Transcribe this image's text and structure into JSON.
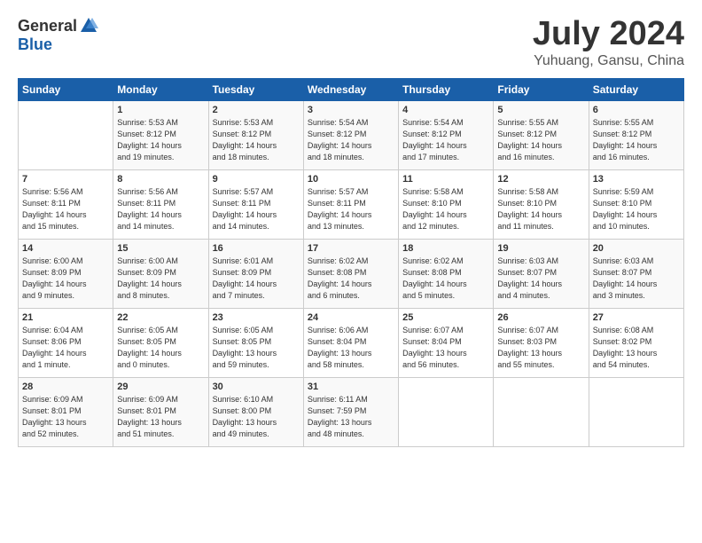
{
  "header": {
    "logo_general": "General",
    "logo_blue": "Blue",
    "title": "July 2024",
    "location": "Yuhuang, Gansu, China"
  },
  "days_of_week": [
    "Sunday",
    "Monday",
    "Tuesday",
    "Wednesday",
    "Thursday",
    "Friday",
    "Saturday"
  ],
  "weeks": [
    [
      {
        "day": "",
        "info": ""
      },
      {
        "day": "1",
        "info": "Sunrise: 5:53 AM\nSunset: 8:12 PM\nDaylight: 14 hours\nand 19 minutes."
      },
      {
        "day": "2",
        "info": "Sunrise: 5:53 AM\nSunset: 8:12 PM\nDaylight: 14 hours\nand 18 minutes."
      },
      {
        "day": "3",
        "info": "Sunrise: 5:54 AM\nSunset: 8:12 PM\nDaylight: 14 hours\nand 18 minutes."
      },
      {
        "day": "4",
        "info": "Sunrise: 5:54 AM\nSunset: 8:12 PM\nDaylight: 14 hours\nand 17 minutes."
      },
      {
        "day": "5",
        "info": "Sunrise: 5:55 AM\nSunset: 8:12 PM\nDaylight: 14 hours\nand 16 minutes."
      },
      {
        "day": "6",
        "info": "Sunrise: 5:55 AM\nSunset: 8:12 PM\nDaylight: 14 hours\nand 16 minutes."
      }
    ],
    [
      {
        "day": "7",
        "info": "Sunrise: 5:56 AM\nSunset: 8:11 PM\nDaylight: 14 hours\nand 15 minutes."
      },
      {
        "day": "8",
        "info": "Sunrise: 5:56 AM\nSunset: 8:11 PM\nDaylight: 14 hours\nand 14 minutes."
      },
      {
        "day": "9",
        "info": "Sunrise: 5:57 AM\nSunset: 8:11 PM\nDaylight: 14 hours\nand 14 minutes."
      },
      {
        "day": "10",
        "info": "Sunrise: 5:57 AM\nSunset: 8:11 PM\nDaylight: 14 hours\nand 13 minutes."
      },
      {
        "day": "11",
        "info": "Sunrise: 5:58 AM\nSunset: 8:10 PM\nDaylight: 14 hours\nand 12 minutes."
      },
      {
        "day": "12",
        "info": "Sunrise: 5:58 AM\nSunset: 8:10 PM\nDaylight: 14 hours\nand 11 minutes."
      },
      {
        "day": "13",
        "info": "Sunrise: 5:59 AM\nSunset: 8:10 PM\nDaylight: 14 hours\nand 10 minutes."
      }
    ],
    [
      {
        "day": "14",
        "info": "Sunrise: 6:00 AM\nSunset: 8:09 PM\nDaylight: 14 hours\nand 9 minutes."
      },
      {
        "day": "15",
        "info": "Sunrise: 6:00 AM\nSunset: 8:09 PM\nDaylight: 14 hours\nand 8 minutes."
      },
      {
        "day": "16",
        "info": "Sunrise: 6:01 AM\nSunset: 8:09 PM\nDaylight: 14 hours\nand 7 minutes."
      },
      {
        "day": "17",
        "info": "Sunrise: 6:02 AM\nSunset: 8:08 PM\nDaylight: 14 hours\nand 6 minutes."
      },
      {
        "day": "18",
        "info": "Sunrise: 6:02 AM\nSunset: 8:08 PM\nDaylight: 14 hours\nand 5 minutes."
      },
      {
        "day": "19",
        "info": "Sunrise: 6:03 AM\nSunset: 8:07 PM\nDaylight: 14 hours\nand 4 minutes."
      },
      {
        "day": "20",
        "info": "Sunrise: 6:03 AM\nSunset: 8:07 PM\nDaylight: 14 hours\nand 3 minutes."
      }
    ],
    [
      {
        "day": "21",
        "info": "Sunrise: 6:04 AM\nSunset: 8:06 PM\nDaylight: 14 hours\nand 1 minute."
      },
      {
        "day": "22",
        "info": "Sunrise: 6:05 AM\nSunset: 8:05 PM\nDaylight: 14 hours\nand 0 minutes."
      },
      {
        "day": "23",
        "info": "Sunrise: 6:05 AM\nSunset: 8:05 PM\nDaylight: 13 hours\nand 59 minutes."
      },
      {
        "day": "24",
        "info": "Sunrise: 6:06 AM\nSunset: 8:04 PM\nDaylight: 13 hours\nand 58 minutes."
      },
      {
        "day": "25",
        "info": "Sunrise: 6:07 AM\nSunset: 8:04 PM\nDaylight: 13 hours\nand 56 minutes."
      },
      {
        "day": "26",
        "info": "Sunrise: 6:07 AM\nSunset: 8:03 PM\nDaylight: 13 hours\nand 55 minutes."
      },
      {
        "day": "27",
        "info": "Sunrise: 6:08 AM\nSunset: 8:02 PM\nDaylight: 13 hours\nand 54 minutes."
      }
    ],
    [
      {
        "day": "28",
        "info": "Sunrise: 6:09 AM\nSunset: 8:01 PM\nDaylight: 13 hours\nand 52 minutes."
      },
      {
        "day": "29",
        "info": "Sunrise: 6:09 AM\nSunset: 8:01 PM\nDaylight: 13 hours\nand 51 minutes."
      },
      {
        "day": "30",
        "info": "Sunrise: 6:10 AM\nSunset: 8:00 PM\nDaylight: 13 hours\nand 49 minutes."
      },
      {
        "day": "31",
        "info": "Sunrise: 6:11 AM\nSunset: 7:59 PM\nDaylight: 13 hours\nand 48 minutes."
      },
      {
        "day": "",
        "info": ""
      },
      {
        "day": "",
        "info": ""
      },
      {
        "day": "",
        "info": ""
      }
    ]
  ]
}
